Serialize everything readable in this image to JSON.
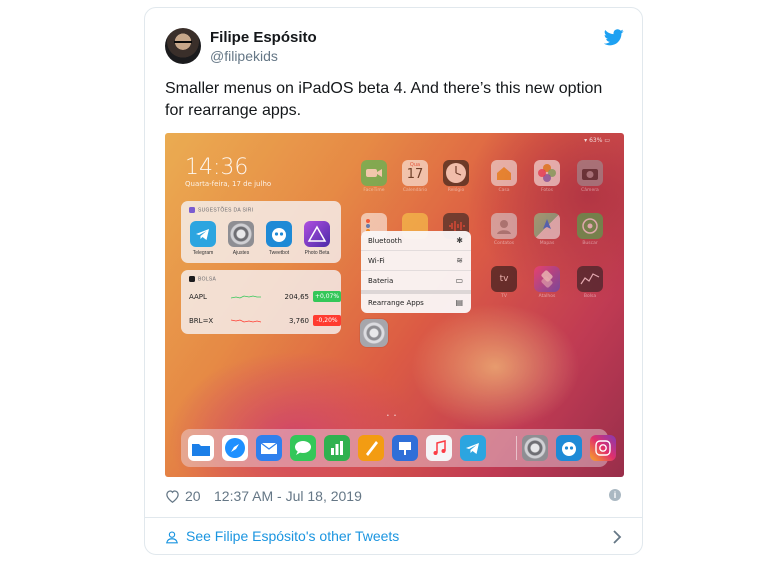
{
  "author": {
    "name": "Filipe Espósito",
    "handle": "@filipekids"
  },
  "tweet": {
    "text": "Smaller menus on iPadOS beta 4. And there’s this new option for rearrange apps."
  },
  "screenshot": {
    "status": "▾ 63% ▭",
    "clock": "14:36",
    "date": "Quarta-feira, 17 de julho",
    "suggestions_widget": {
      "title": "SUGESTÕES DA SIRI",
      "apps": [
        {
          "label": "Telegram",
          "color": "#2ca5e0"
        },
        {
          "label": "Ajustes",
          "color": "#8e8e93"
        },
        {
          "label": "Tweetbot",
          "color": "#1e8ad6"
        },
        {
          "label": "Photo Beta",
          "color": "#7b3fd1"
        }
      ]
    },
    "stocks_widget": {
      "title": "BOLSA",
      "rows": [
        {
          "symbol": "AAPL",
          "price": "204,65",
          "change": "+0,07%",
          "change_color": "#34c759"
        },
        {
          "symbol": "BRL=X",
          "price": "3,760",
          "change": "-0,20%",
          "change_color": "#ff3b30"
        }
      ]
    },
    "home_apps": [
      {
        "label": "FaceTime",
        "color": "#34c759",
        "icon": "facetime-icon"
      },
      {
        "label": "Calendário",
        "color": "#ffffff",
        "icon": "calendar-icon",
        "day_name": "Qua",
        "day_number": "17"
      },
      {
        "label": "Relógio",
        "color": "#111111",
        "icon": "clock-icon"
      },
      {
        "label": "Casa",
        "color": "#f5f5f5",
        "icon": "home-icon"
      },
      {
        "label": "Fotos",
        "color": "#ffffff",
        "icon": "photos-icon"
      },
      {
        "label": "Câmera",
        "color": "#9a9a9f",
        "icon": "camera-icon"
      },
      {
        "label": "",
        "color": "#ffffff",
        "icon": "reminders-icon"
      },
      {
        "label": "",
        "color": "#fcd34d",
        "icon": "notes-icon"
      },
      {
        "label": "",
        "color": "#1c1c1e",
        "icon": "voice-memos-icon"
      },
      {
        "label": "Contatos",
        "color": "#d8d8dc",
        "icon": "contacts-icon"
      },
      {
        "label": "Mapas",
        "color": "#6fcf97",
        "icon": "maps-icon"
      },
      {
        "label": "Buscar",
        "color": "#3fb950",
        "icon": "find-my-icon"
      },
      {
        "label": "TV",
        "color": "#111111",
        "icon": "tv-icon",
        "text": "tv"
      },
      {
        "label": "Atalhos",
        "color": "#3a4bd8",
        "icon": "shortcuts-icon"
      },
      {
        "label": "Bolsa",
        "color": "#1c1c1e",
        "icon": "stocks-icon"
      }
    ],
    "context_menu": [
      {
        "label": "Bluetooth",
        "glyph": "✱",
        "icon": "bluetooth-icon"
      },
      {
        "label": "Wi-Fi",
        "glyph": "≋",
        "icon": "wifi-icon"
      },
      {
        "label": "Bateria",
        "glyph": "▭",
        "icon": "battery-icon"
      },
      {
        "label": "Rearrange Apps",
        "glyph": "▤",
        "icon": "rearrange-icon"
      }
    ],
    "dock_apps": [
      {
        "name": "files-icon",
        "color": "#1b7fe8"
      },
      {
        "name": "safari-icon",
        "color": "#1e90ff"
      },
      {
        "name": "mail-icon",
        "color": "#2f80ed"
      },
      {
        "name": "messages-icon",
        "color": "#34c759"
      },
      {
        "name": "numbers-icon",
        "color": "#30b14f"
      },
      {
        "name": "pages-icon",
        "color": "#f39c12"
      },
      {
        "name": "keynote-icon",
        "color": "#2f6fd8"
      },
      {
        "name": "music-icon",
        "color": "#f5f5f7"
      },
      {
        "name": "telegram-icon",
        "color": "#2ca5e0"
      },
      {
        "name": "settings-icon",
        "color": "#8e8e93"
      },
      {
        "name": "tweetbot-icon",
        "color": "#1e8ad6"
      },
      {
        "name": "instagram-icon",
        "color": "#c13584"
      }
    ]
  },
  "footer": {
    "like_count": "20",
    "timestamp": "12:37 AM - Jul 18, 2019",
    "more_tweets": "See Filipe Espósito's other Tweets"
  },
  "colors": {
    "link": "#1b95e0",
    "twitter_blue": "#1da1f2",
    "muted": "#657786"
  }
}
